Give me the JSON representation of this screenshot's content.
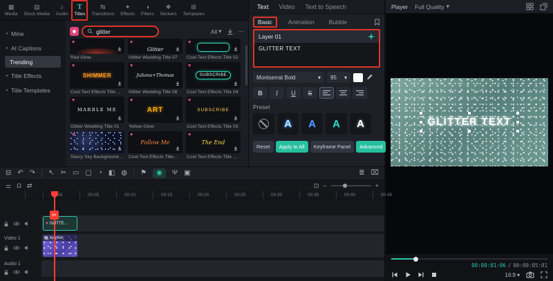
{
  "icons": {
    "heart": "♥",
    "dropdown": "▾",
    "chevron": "▸",
    "more": "⋯",
    "minus": "−",
    "plus": "+",
    "fit": "⊡",
    "media_tag": "▦"
  },
  "tabbar": {
    "tabs": [
      {
        "label": "Media",
        "icon": "▦"
      },
      {
        "label": "Stock Media",
        "icon": "▤"
      },
      {
        "label": "Audio",
        "icon": "♪"
      },
      {
        "label": "Titles",
        "icon": "T"
      },
      {
        "label": "Transitions",
        "icon": "⇆"
      },
      {
        "label": "Effects",
        "icon": "✦"
      },
      {
        "label": "Filters",
        "icon": "◑"
      },
      {
        "label": "Stickers",
        "icon": "❖"
      },
      {
        "label": "Templates",
        "icon": "⊞"
      }
    ]
  },
  "sidebar": {
    "items": [
      {
        "label": "Mine"
      },
      {
        "label": "AI Captions"
      },
      {
        "label": "Trending"
      },
      {
        "label": "Title Effects"
      },
      {
        "label": "Title Templates"
      }
    ]
  },
  "library": {
    "search_value": "glitter",
    "filter_label": "All",
    "items": [
      {
        "label": "Red Glow",
        "thumb_text": ""
      },
      {
        "label": "Glitter Wedding Title 07",
        "thumb_text": "Glitter"
      },
      {
        "label": "Cool Text Effects Title 02",
        "thumb_text": ""
      },
      {
        "label": "Cool Text Effects Title ...",
        "thumb_text": "SHIMMER"
      },
      {
        "label": "Glitter Wedding Title 08",
        "thumb_text": "Juliana+Thomas"
      },
      {
        "label": "Cool Text Effects Title 04",
        "thumb_text": "SUBSCRIBE"
      },
      {
        "label": "Glitter Wedding Title 01",
        "thumb_text": "MARBLE ME"
      },
      {
        "label": "Yellow Glow",
        "thumb_text": "ART"
      },
      {
        "label": "Cool Text Effects Title 03",
        "thumb_text": "SUBSCRIBE"
      },
      {
        "label": "Starry Sky Background...",
        "thumb_text": ""
      },
      {
        "label": "Cool Text Effects Title...",
        "thumb_text": "Follow Me"
      },
      {
        "label": "Cool Text Effects Title ...",
        "thumb_text": "The End"
      }
    ]
  },
  "text_panel": {
    "tabs": [
      {
        "label": "Text"
      },
      {
        "label": "Video"
      },
      {
        "label": "Text to Speech"
      }
    ],
    "subtabs": [
      {
        "label": "Basic"
      },
      {
        "label": "Animation"
      },
      {
        "label": "Bubble"
      }
    ],
    "layer_label": "Layer 01",
    "text_value": "GLITTER TEXT",
    "font_name": "Montserrat Bold",
    "font_size": "95",
    "format": {
      "bold": "B",
      "italic": "I",
      "underline": "U",
      "strike": "S"
    },
    "preset_label": "Preset",
    "preset_letter": "A",
    "actions": [
      {
        "label": "Reset"
      },
      {
        "label": "Apply to All"
      },
      {
        "label": "Keyframe Panel"
      },
      {
        "label": "Advanced"
      }
    ]
  },
  "player": {
    "label": "Player",
    "quality": "Full Quality",
    "preview_text": "GLITTER TEXT",
    "time_current": "00:00:01:06",
    "time_separator": "/",
    "time_total": "00:00:05:01",
    "aspect_ratio": "16:9"
  },
  "timeline": {
    "ruler": [
      "00:00",
      "00:05",
      "00:10",
      "00:15",
      "00:20",
      "00:25",
      "00:30",
      "00:35",
      "00:40",
      "00:45"
    ],
    "title_clip_label": "GLITTE...",
    "video_clip_label": "sparkle",
    "video_track_label": "Video 1",
    "audio_track_label": "Audio 1"
  },
  "timeline_toolbar": {
    "left": [
      {
        "name": "panel-layout-icon",
        "glyph": "⊟"
      },
      {
        "name": "undo-icon",
        "glyph": "↶"
      },
      {
        "name": "redo-icon",
        "glyph": "↷"
      },
      {
        "name": "pointer-tool-icon",
        "glyph": "↖"
      },
      {
        "name": "razor-tool-icon",
        "glyph": "✂"
      },
      {
        "name": "trim-tool-icon",
        "glyph": "▭"
      },
      {
        "name": "crop-tool-icon",
        "glyph": "▢"
      },
      {
        "name": "speed-tool-icon",
        "glyph": "◔"
      },
      {
        "name": "color-tool-icon",
        "glyph": "◧"
      },
      {
        "name": "mask-tool-icon",
        "glyph": "◍"
      }
    ],
    "center": [
      {
        "name": "marker-tool-icon",
        "glyph": "⚑"
      },
      {
        "name": "record-voiceover-icon",
        "glyph": "◉"
      },
      {
        "name": "mic-icon",
        "glyph": "Ψ"
      },
      {
        "name": "screen-record-icon",
        "glyph": "▣"
      }
    ],
    "right": [
      {
        "name": "render-preview-icon",
        "glyph": "≣"
      },
      {
        "name": "delete-icon",
        "glyph": "⌧"
      }
    ],
    "sub_left": [
      {
        "name": "manage-tracks-icon",
        "glyph": "⚌"
      },
      {
        "name": "magnet-icon",
        "glyph": "Ω"
      },
      {
        "name": "auto-ripple-icon",
        "glyph": "⇄"
      }
    ]
  }
}
